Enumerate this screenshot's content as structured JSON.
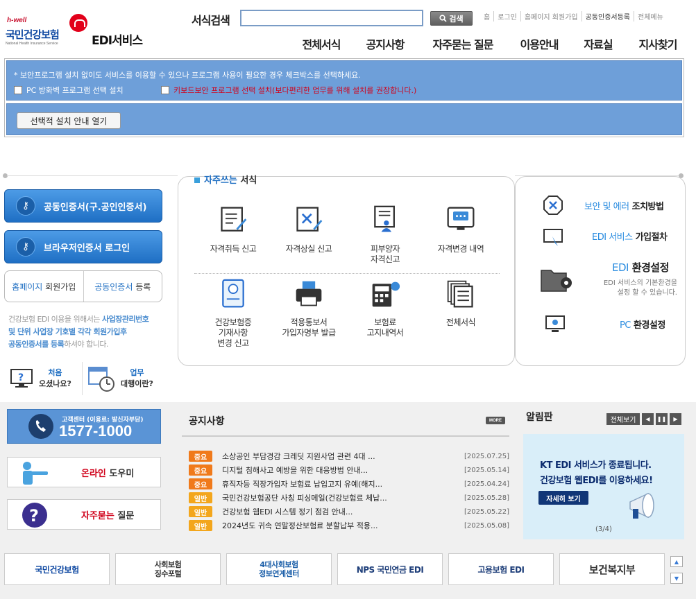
{
  "header": {
    "logo_hwell": "h-well",
    "logo_kr": "국민건강보험",
    "logo_en": "National Health Insurance Service",
    "logo_service": "EDI서비스",
    "search_label": "서식검색",
    "search_value": "",
    "search_button": "검색",
    "top_links": [
      "홈",
      "로그인",
      "홈페이지 회원가입",
      "공동인증서등록",
      "전체메뉴"
    ],
    "gnb": [
      "전체서식",
      "공지사항",
      "자주묻는 질문",
      "이용안내",
      "자료실",
      "지사찾기"
    ]
  },
  "security": {
    "note": "* 보안프로그램 설치 없이도 서비스를 이용할 수 있으나 프로그램 사용이 필요한 경우 체크박스를 선택하세요.",
    "option1": "PC 방화벽 프로그램 선택 설치",
    "option2": "키보드보안 프로그램 선택 설치(보다편리한 업무를 위해 설치를 권장합니다.)",
    "guide_button": "선택적 설치 안내 열기"
  },
  "left": {
    "cert_login": "공동인증서(구.공인인증서)",
    "browser_login": "브라우저인증서 로그인",
    "join_a": "홈페이지",
    "join_b": "회원가입",
    "reg_a": "공동인증서",
    "reg_b": "등록",
    "note_1": "건강보험 EDI 이용을 위해서는",
    "note_2": "사업장관리번호",
    "note_3": "및 단위 사업장 기호별 각각 회원가입후",
    "note_4": "공동인증서를 등록",
    "note_5": "하셔야 합니다.",
    "first_a": "처음",
    "first_b": "오셨나요?",
    "agent_a": "업무",
    "agent_b": "대행이란?"
  },
  "forms": {
    "title_a": "자주쓰는",
    "title_b": "서식",
    "items": [
      {
        "label": "자격취득 신고"
      },
      {
        "label": "자격상실 신고"
      },
      {
        "label": "피부양자\n자격신고"
      },
      {
        "label": "자격변경 내역"
      },
      {
        "label": "건강보험증\n기재사항\n변경 신고"
      },
      {
        "label": "적용통보서\n가입자명부 발급"
      },
      {
        "label": "보험료\n고지내역서"
      },
      {
        "label": "전체서식"
      }
    ]
  },
  "right": {
    "security_a": "보안 및 에러",
    "security_b": "조치방법",
    "join_a": "EDI 서비스",
    "join_b": "가입절차",
    "env_a": "EDI",
    "env_b": "환경설정",
    "env_sub": "EDI 서비스의 기본환경을\n설정 할 수 있습니다.",
    "pc_a": "PC",
    "pc_b": "환경설정"
  },
  "support": {
    "call_label": "고객센터 (이용료: 발신자부담)",
    "call_number": "1577-1000",
    "helper_a": "온라인",
    "helper_b": "도우미",
    "faq_a": "자주묻는",
    "faq_b": "질문"
  },
  "notices": {
    "title": "공지사항",
    "more": "MORE",
    "rows": [
      {
        "badge": "중요",
        "type": "imp",
        "title": "소상공인 부담경감 크레딧 지원사업 관련 4대 ...",
        "date": "[2025.07.25]"
      },
      {
        "badge": "중요",
        "type": "imp",
        "title": "디지털 침해사고 예방을 위한 대응방법 안내...",
        "date": "[2025.05.14]"
      },
      {
        "badge": "중요",
        "type": "imp",
        "title": "휴직자등 직장가입자 보험료 납입고지 유예(해지...",
        "date": "[2025.04.24]"
      },
      {
        "badge": "일반",
        "type": "gen",
        "title": "국민건강보험공단 사칭 피싱메일(건강보험료 체납...",
        "date": "[2025.05.28]"
      },
      {
        "badge": "일반",
        "type": "gen",
        "title": "건강보험 웹EDI 시스템 정기 점검 안내...",
        "date": "[2025.05.22]"
      },
      {
        "badge": "일반",
        "type": "gen",
        "title": "2024년도 귀속 연말정산보험료 분할납부 적용...",
        "date": "[2025.05.08]"
      }
    ]
  },
  "alarm": {
    "title": "알림판",
    "view_all": "전체보기",
    "line1": "KT EDI 서비스가 종료됩니다.",
    "line2": "건강보험 웹EDI를 이용하세요!",
    "detail": "자세히 보기",
    "page": "(3/4)"
  },
  "footer_logos": [
    "국민건강보험",
    "사회보험\n징수포털",
    "4대사회보험\n정보연계센터",
    "NPS 국민연금 EDI",
    "고용보험 EDI",
    "보건복지부"
  ]
}
